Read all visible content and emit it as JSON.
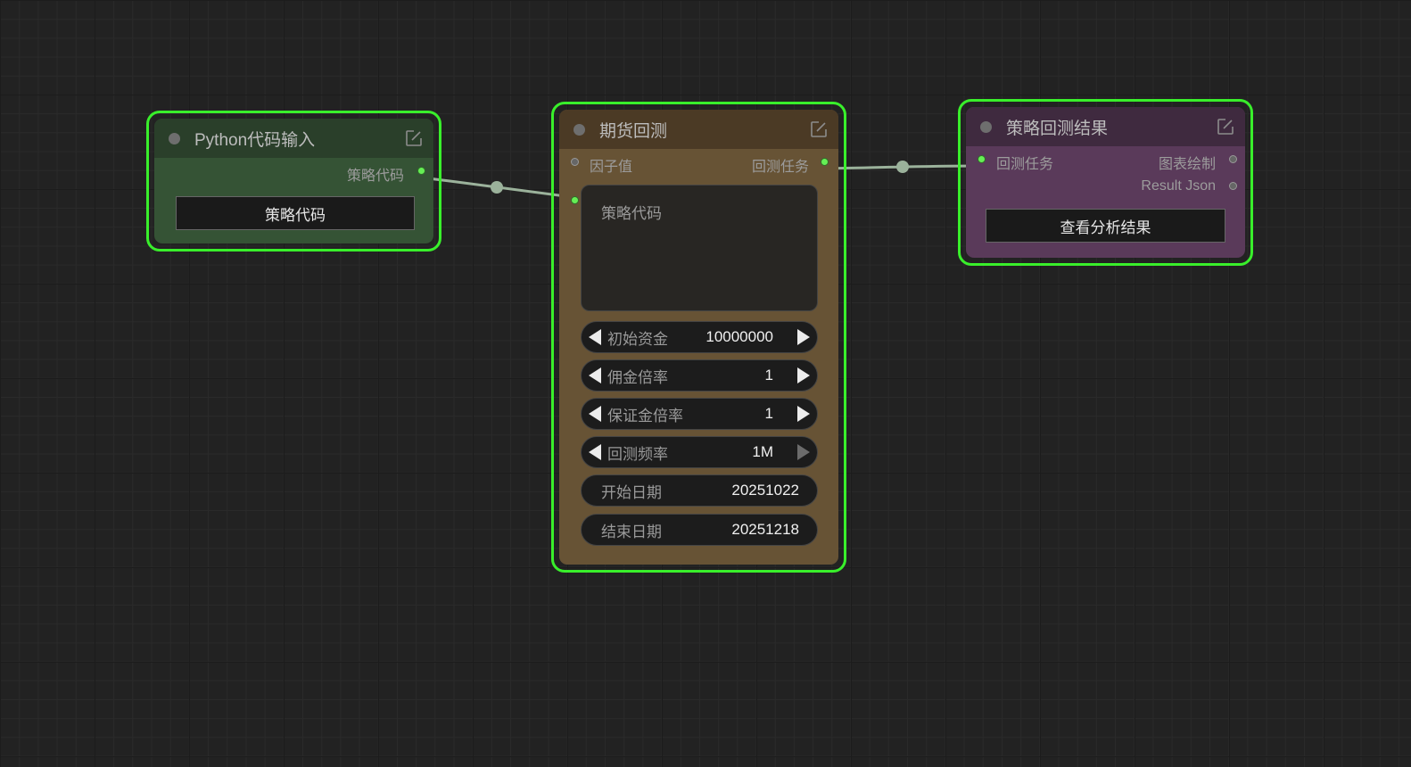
{
  "nodes": {
    "python_input": {
      "title": "Python代码输入",
      "output_label": "策略代码",
      "button_label": "策略代码"
    },
    "futures_backtest": {
      "title": "期货回测",
      "input_factor_label": "因子值",
      "output_label": "回测任务",
      "code_placeholder": "策略代码",
      "widgets": [
        {
          "label": "初始资金",
          "value": "10000000"
        },
        {
          "label": "佣金倍率",
          "value": "1"
        },
        {
          "label": "保证金倍率",
          "value": "1"
        },
        {
          "label": "回测频率",
          "value": "1M"
        },
        {
          "label": "开始日期",
          "value": "20251022"
        },
        {
          "label": "结束日期",
          "value": "20251218"
        }
      ]
    },
    "backtest_result": {
      "title": "策略回测结果",
      "input_label": "回测任务",
      "outputs": [
        "图表绘制",
        "Result Json"
      ],
      "button_label": "查看分析结果"
    }
  },
  "colors": {
    "selection_outline": "#39ef2b",
    "python_node_title": "#2a3f2a",
    "python_node_body": "#355335",
    "backtest_node_title": "#4b3a25",
    "backtest_node_body": "#675335",
    "result_node_title": "#3f2a3f",
    "result_node_body": "#5a3a5a",
    "link": "#9bb29b"
  }
}
